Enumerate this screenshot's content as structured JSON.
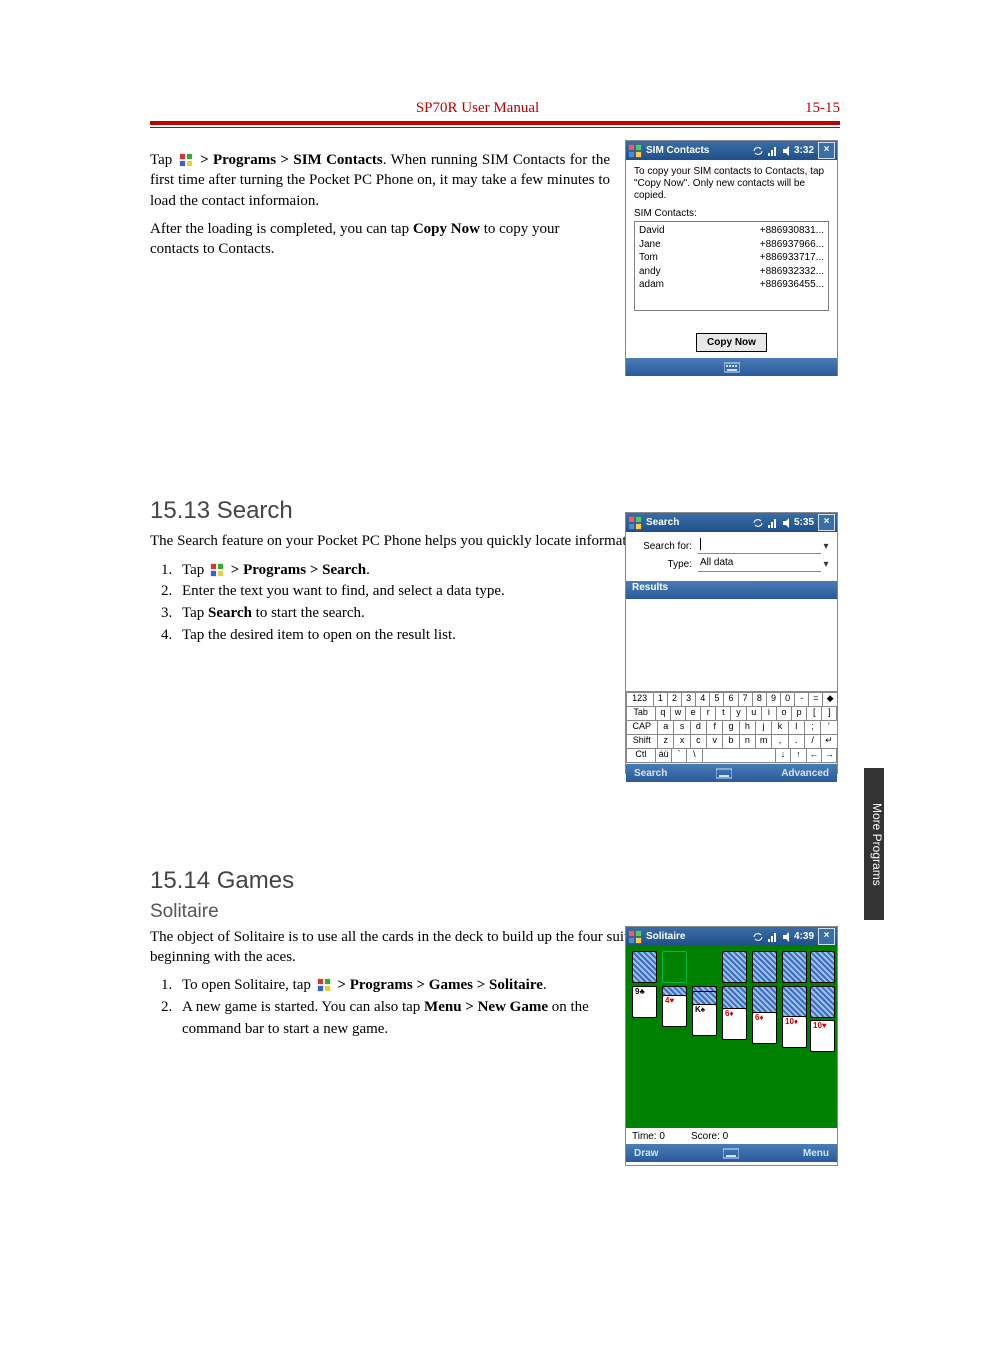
{
  "header": {
    "title": "SP70R User Manual",
    "page_no": "15-15"
  },
  "side_tab": "More Programs",
  "sim_section": {
    "p1_lead": "Tap ",
    "p1_tail": " > Programs > SIM Contacts",
    "p1_rest": ". When running SIM Contacts for the first time after turning the Pocket PC Phone on, it may take a few minutes to load the contact informaion.",
    "p2_a": "After the loading is completed, you can tap ",
    "p2_b": "Copy Now",
    "p2_c": " to copy your contacts to Contacts."
  },
  "search_section": {
    "h": "15.13  Search",
    "intro": "The Search feature on your Pocket PC Phone helps you quickly locate information.",
    "steps": [
      {
        "lead": "Tap ",
        "b": "> Programs > Search",
        "rest": "."
      },
      {
        "plain": "Enter the text you want to find, and select a data type."
      },
      {
        "lead": "Tap ",
        "b": "Search",
        "rest": " to start the search."
      },
      {
        "plain": "Tap the desired item to open on the result list."
      }
    ]
  },
  "games_section": {
    "h": "15.14  Games",
    "sub": "Solitaire",
    "intro": "The object of Solitaire is to use all the cards in the deck to build up the four suit stacks in ascending order, beginning with the aces.",
    "steps": [
      {
        "lead": "To open Solitaire, tap ",
        "b": "> Programs > Games > Solitaire",
        "rest": "."
      },
      {
        "lead": "A new game is started. You can also tap ",
        "b": "Menu > New Game",
        "rest": " on the command bar to start a new game."
      }
    ]
  },
  "shot_sim": {
    "title": "SIM Contacts",
    "time": "3:32",
    "hint": "To copy your SIM contacts to Contacts, tap \"Copy Now\". Only new contacts will be copied.",
    "list_label": "SIM Contacts:",
    "contacts": [
      {
        "name": "David",
        "num": "+886930831..."
      },
      {
        "name": "Jane",
        "num": "+886937966..."
      },
      {
        "name": "Tom",
        "num": "+886933717..."
      },
      {
        "name": "andy",
        "num": "+886932332..."
      },
      {
        "name": "adam",
        "num": "+886936455..."
      }
    ],
    "button": "Copy Now"
  },
  "shot_search": {
    "title": "Search",
    "time": "5:35",
    "field_searchfor": "Search for:",
    "field_type": "Type:",
    "type_value": "All data",
    "results": "Results",
    "left": "Search",
    "right": "Advanced",
    "sip_row1": [
      "123",
      "1",
      "2",
      "3",
      "4",
      "5",
      "6",
      "7",
      "8",
      "9",
      "0",
      "-",
      "=",
      "◆"
    ],
    "sip_row2": [
      "Tab",
      "q",
      "w",
      "e",
      "r",
      "t",
      "y",
      "u",
      "i",
      "o",
      "p",
      "[",
      "]"
    ],
    "sip_row3": [
      "CAP",
      "a",
      "s",
      "d",
      "f",
      "g",
      "h",
      "j",
      "k",
      "l",
      ";",
      "'"
    ],
    "sip_row4": [
      "Shift",
      "z",
      "x",
      "c",
      "v",
      "b",
      "n",
      "m",
      ",",
      ".",
      "/",
      "↵"
    ],
    "sip_row5": [
      "Ctl",
      "áü",
      "`",
      "\\",
      " ",
      "↓",
      "↑",
      "←",
      "→"
    ]
  },
  "shot_sol": {
    "title": "Solitaire",
    "time": "4:39",
    "status_time": "Time: 0",
    "status_score": "Score: 0",
    "left": "Draw",
    "right": "Menu",
    "tableau": [
      {
        "rank": "9",
        "suit": "♣",
        "red": false
      },
      {
        "rank": "4",
        "suit": "♥",
        "red": true
      },
      {
        "rank": "K",
        "suit": "♠",
        "red": false
      },
      {
        "rank": "6",
        "suit": "♦",
        "red": true
      },
      {
        "rank": "6",
        "suit": "♦",
        "red": true
      },
      {
        "rank": "10",
        "suit": "♦",
        "red": true
      },
      {
        "rank": "10",
        "suit": "♥",
        "red": true
      }
    ]
  }
}
